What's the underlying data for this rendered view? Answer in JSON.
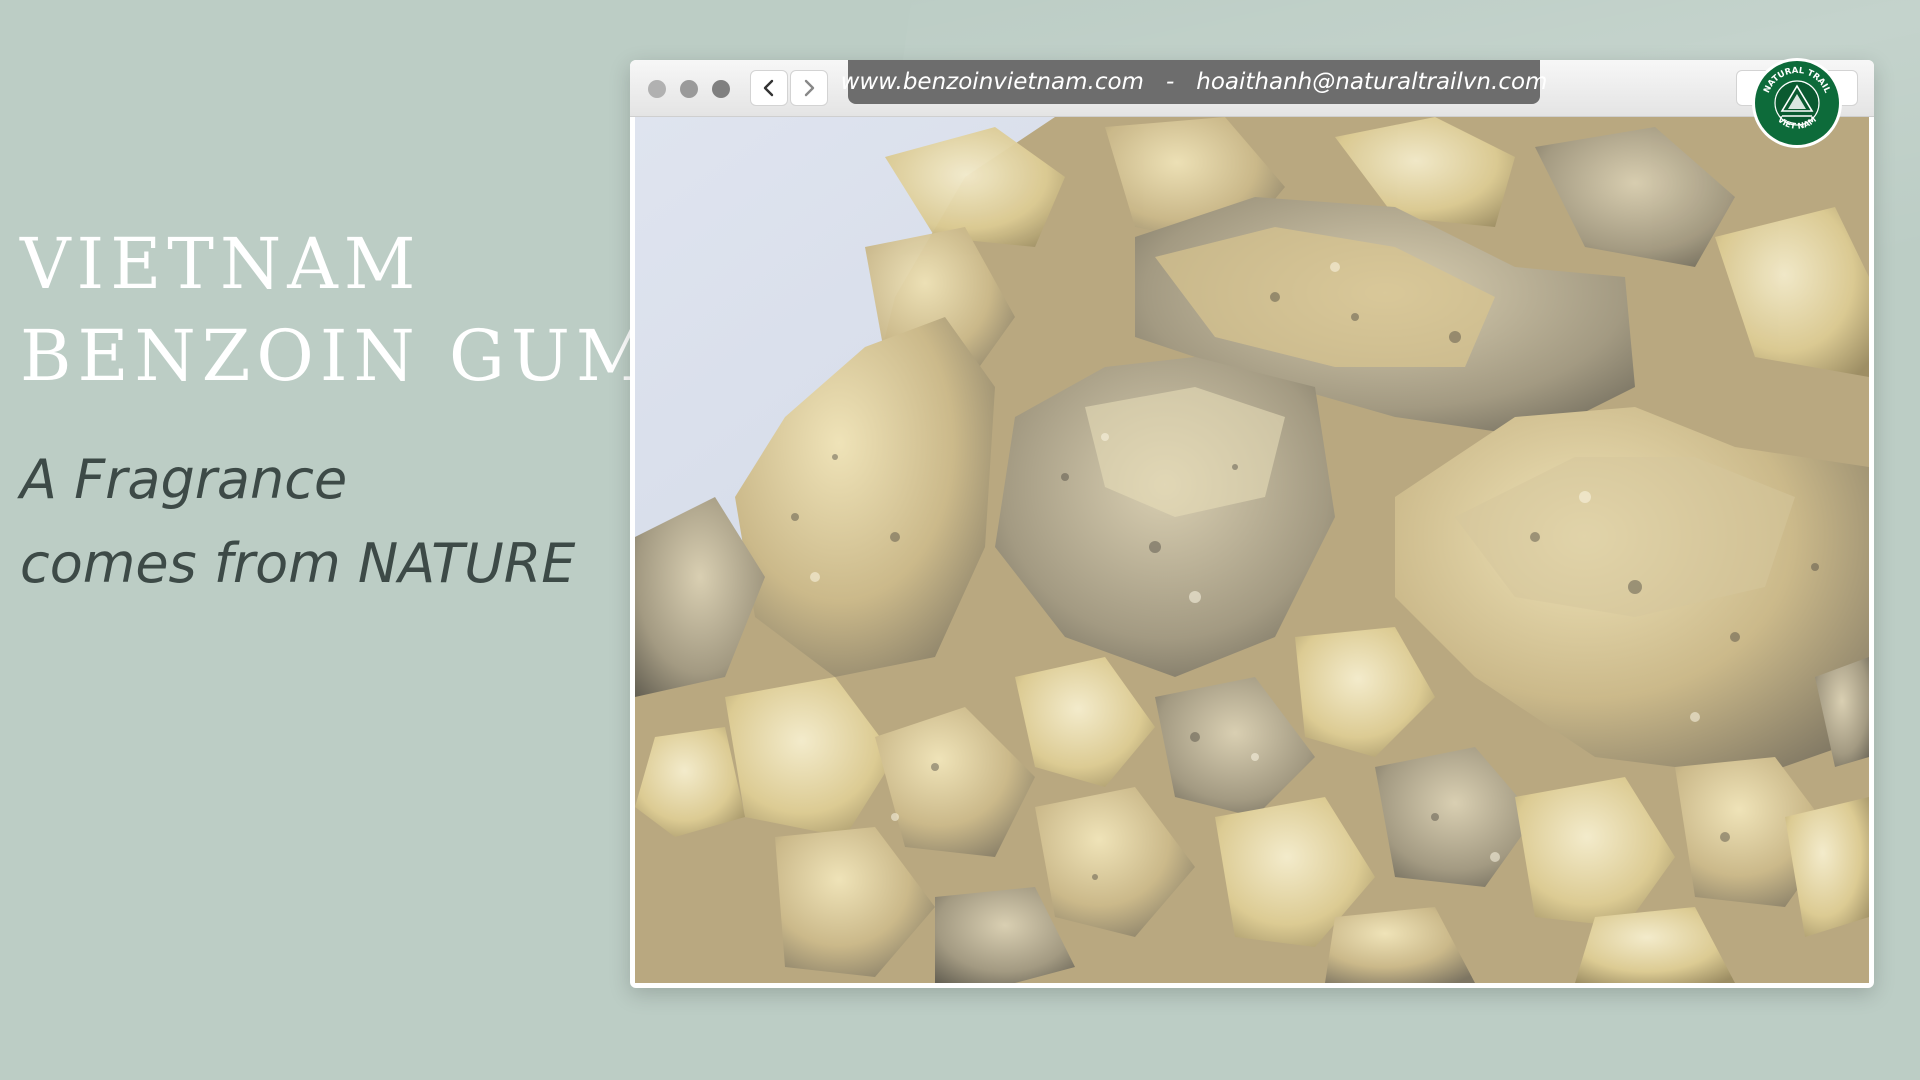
{
  "headline": {
    "line1": "VIETNAM",
    "line2": "BENZOIN GUM"
  },
  "tagline": {
    "line1": "A Fragrance",
    "line2": "comes from NATURE"
  },
  "browser": {
    "website": "www.benzoinvietnam.com",
    "separator": "-",
    "email": "hoaithanh@naturaltrailvn.com"
  },
  "logo": {
    "top_text": "NATURAL TRAIL",
    "bottom_text": "VIET NAM",
    "color": "#0d6b3a"
  },
  "colors": {
    "background": "#bccdc5",
    "headline": "#ffffff",
    "tagline": "#3d4a47",
    "address_bar": "#6d6d6d"
  },
  "icons": {
    "back": "chevron-left-icon",
    "forward": "chevron-right-icon"
  },
  "photo": {
    "subject": "benzoin resin pieces"
  }
}
